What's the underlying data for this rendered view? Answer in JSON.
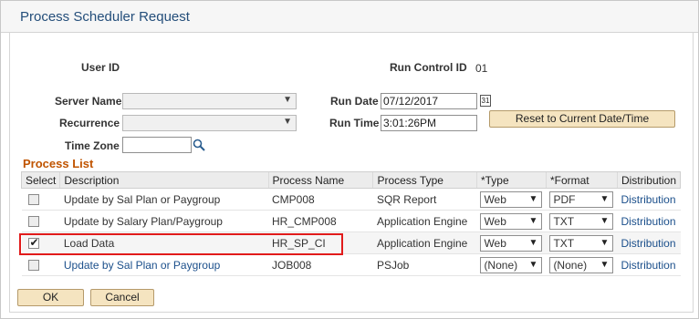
{
  "window": {
    "title": "Process Scheduler Request"
  },
  "header": {
    "user_id_label": "User ID",
    "run_control_label": "Run Control ID",
    "run_control_value": "01",
    "server_name_label": "Server Name",
    "recurrence_label": "Recurrence",
    "time_zone_label": "Time Zone",
    "run_date_label": "Run Date",
    "run_date_value": "07/12/2017",
    "run_time_label": "Run Time",
    "run_time_value": "3:01:26PM",
    "reset_button": "Reset to Current Date/Time"
  },
  "process_list": {
    "title": "Process List",
    "columns": [
      "Select",
      "Description",
      "Process Name",
      "Process Type",
      "*Type",
      "*Format",
      "Distribution"
    ],
    "rows": [
      {
        "selected": false,
        "description": "Update by Sal Plan or Paygroup",
        "description_link": false,
        "process_name": "CMP008",
        "process_type": "SQR Report",
        "type": "Web",
        "format": "PDF",
        "distribution": "Distribution"
      },
      {
        "selected": false,
        "description": "Update by Salary Plan/Paygroup",
        "description_link": false,
        "process_name": "HR_CMP008",
        "process_type": "Application Engine",
        "type": "Web",
        "format": "TXT",
        "distribution": "Distribution"
      },
      {
        "selected": true,
        "description": "Load Data",
        "description_link": false,
        "process_name": "HR_SP_CI",
        "process_type": "Application Engine",
        "type": "Web",
        "format": "TXT",
        "distribution": "Distribution"
      },
      {
        "selected": false,
        "description": "Update by Sal Plan or Paygroup",
        "description_link": true,
        "process_name": "JOB008",
        "process_type": "PSJob",
        "type": "(None)",
        "format": "(None)",
        "distribution": "Distribution"
      }
    ]
  },
  "footer": {
    "ok_button": "OK",
    "cancel_button": "Cancel"
  },
  "colors": {
    "title": "#244e7a",
    "section": "#c05400",
    "link": "#1b4f8b",
    "highlight": "#e11b1b",
    "button": "#f5e4c0"
  }
}
